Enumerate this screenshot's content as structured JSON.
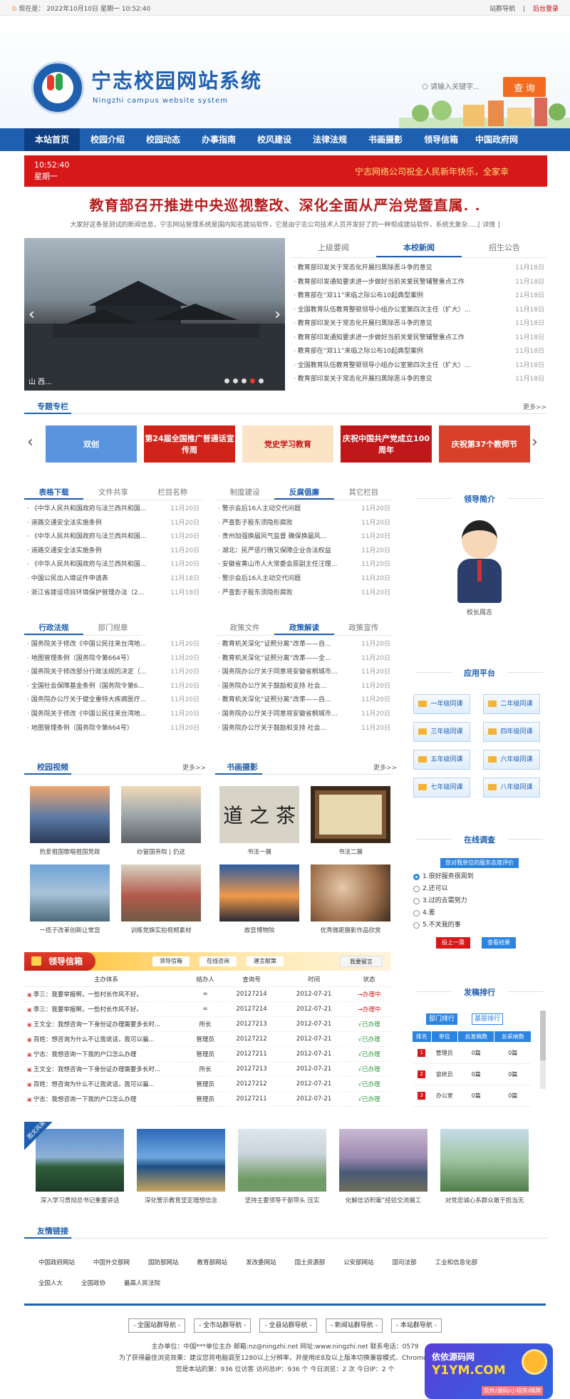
{
  "topbar": {
    "now_label": "现在是：",
    "datetime": "2022年10月10日 星期一 10:52:40",
    "sitegroup": "站群导航",
    "admin_login": "后台登录"
  },
  "header": {
    "title": "宁志校园网站系统",
    "subtitle": "Ningzhi campus website system",
    "search_placeholder": "请输入关键字...",
    "search_button": "查 询"
  },
  "nav": [
    "本站首页",
    "校园介绍",
    "校园动态",
    "办事指南",
    "校风建设",
    "法律法规",
    "书画摄影",
    "领导信箱",
    "中国政府网"
  ],
  "ticker": {
    "time": "10:52:40",
    "weekday": "星期一",
    "message": "宁志网络公司祝全人民新年快乐，全家幸"
  },
  "headline": {
    "title": "教育部召开推进中央巡视整改、深化全面从严治党暨直属. .",
    "desc": "大家好这条是测试的新闻信息，宁志网站管理系统是国内知名建站软件，它是由宁志公司技术人员开发好了的一种现成建站软件，系统无复杂.....[ 详情 ]"
  },
  "slider": {
    "caption": "山 西..."
  },
  "news": {
    "tabs": [
      "上级要闻",
      "本校新闻",
      "招生公告"
    ],
    "items": [
      {
        "t": "教育部印发关于常态化开展扫黑除恶斗争的意见",
        "d": "11月18日"
      },
      {
        "t": "教育部印发通知要求进一步做好当前关爱民警辅警重点工作",
        "d": "11月18日"
      },
      {
        "t": "教育部在“双11”来临之际公布10起典型案例",
        "d": "11月18日"
      },
      {
        "t": "全国教育队伍教育整顿领导小组办公室第四次主任（扩大）...",
        "d": "11月18日"
      },
      {
        "t": "教育部印发关于常态化开展扫黑除恶斗争的意见",
        "d": "11月18日"
      },
      {
        "t": "教育部印发通知要求进一步做好当前关爱民警辅警重点工作",
        "d": "11月18日"
      },
      {
        "t": "教育部在“双11”来临之际公布10起典型案例",
        "d": "11月18日"
      },
      {
        "t": "全国教育队伍教育整顿领导小组办公室第四次主任（扩大）...",
        "d": "11月18日"
      },
      {
        "t": "教育部印发关于常态化开展扫黑除恶斗争的意见",
        "d": "11月18日"
      }
    ]
  },
  "special": {
    "title": "专题专栏",
    "more": "更多>>",
    "banners": [
      "双创",
      "第24届全国推广普通话宣传周",
      "党史学习教育",
      "庆祝中国共产党成立100周年",
      "庆祝第37个教师节"
    ]
  },
  "col1": {
    "tabs": [
      "表格下载",
      "文件共享",
      "栏目名称"
    ],
    "items": [
      {
        "t": "《中华人民共和国政府与法兰西共和国...",
        "d": "11月20日"
      },
      {
        "t": "道路交通安全法实施条例",
        "d": "11月20日"
      },
      {
        "t": "《中华人民共和国政府与法兰西共和国...",
        "d": "11月20日"
      },
      {
        "t": "道路交通安全法实施条例",
        "d": "11月20日"
      },
      {
        "t": "《中华人民共和国政府与法兰西共和国...",
        "d": "11月20日"
      },
      {
        "t": "中国公民出入境证件申请表",
        "d": "11月18日"
      },
      {
        "t": "浙江省建设项目环境保护管理办法（2...",
        "d": "11月18日"
      }
    ]
  },
  "col2": {
    "tabs": [
      "制度建设",
      "反腐倡廉",
      "其它栏目"
    ],
    "items": [
      {
        "t": "警示会后16人主动交代问题",
        "d": "11月20日"
      },
      {
        "t": "严查影子股东须隐形腐败",
        "d": "11月20日"
      },
      {
        "t": "贵州加强换届风气监督 确保换届风...",
        "d": "11月20日"
      },
      {
        "t": "湖北：民严惩行贿又保障企业合法权益",
        "d": "11月20日"
      },
      {
        "t": "安徽省黄山市人大常委会原副主任汪理...",
        "d": "11月20日"
      },
      {
        "t": "警示会后16人主动交代问题",
        "d": "11月20日"
      },
      {
        "t": "严查影子股东须隐形腐败",
        "d": "11月20日"
      }
    ]
  },
  "col3": {
    "tabs": [
      "行政法规",
      "部门规章"
    ],
    "items": [
      {
        "t": "国务院关于修改《中国公民往来台湾地...",
        "d": "11月20日"
      },
      {
        "t": "地图管理条例（国务院令第664号）",
        "d": "11月20日"
      },
      {
        "t": "国务院关于修改部分行政法规的决定（...",
        "d": "11月20日"
      },
      {
        "t": "全国社会保障基金条例（国务院令第6...",
        "d": "11月20日"
      },
      {
        "t": "国务院办公厅关于健全重特大疾病医疗...",
        "d": "11月20日"
      },
      {
        "t": "国务院关于修改《中国公民往来台湾地...",
        "d": "11月20日"
      },
      {
        "t": "地图管理条例（国务院令第664号）",
        "d": "11月20日"
      }
    ]
  },
  "col4": {
    "tabs": [
      "政策文件",
      "政策解读",
      "政策宣传"
    ],
    "items": [
      {
        "t": "教育机关深化“证照分离”改革——自...",
        "d": "11月20日"
      },
      {
        "t": "教育机关深化“证照分离”改革——全...",
        "d": "11月20日"
      },
      {
        "t": "国务院办公厅关于同意将安徽省桐城市 列...",
        "d": "11月20日"
      },
      {
        "t": "国务院办公厅关于鼓励和支持 社会...",
        "d": "11月20日"
      },
      {
        "t": "教育机关深化“证照分离”改革——自...",
        "d": "11月20日"
      },
      {
        "t": "国务院办公厅关于同意将安徽省桐城市 列...",
        "d": "11月20日"
      },
      {
        "t": "国务院办公厅关于鼓励和支持 社会...",
        "d": "11月20日"
      }
    ]
  },
  "side": {
    "leader_title": "领导简介",
    "leader_caption": "校长周志",
    "apps_title": "应用平台",
    "apps": [
      "一年级同课",
      "二年级同课",
      "三年级同课",
      "四年级同课",
      "五年级同课",
      "六年级同课",
      "七年级同课",
      "八年级同课"
    ],
    "survey_title": "在线调查",
    "survey_q": "您对我单位的服务态度评价",
    "survey_opts": [
      "1.很好服务很周到",
      "2.还可以",
      "3.过的去需努力",
      "4.差",
      "5.不关我的事"
    ],
    "survey_vote": "投上一票",
    "survey_result": "查看结果",
    "rank_title": "发稿排行",
    "rank_tabs": [
      "部门排行",
      "基层排行"
    ],
    "rank_headers": [
      "排名",
      "单位",
      "总发稿数",
      "总采纳数"
    ],
    "rank_rows": [
      {
        "n": "1",
        "u": "管理员",
        "a": "0篇",
        "b": "0篇"
      },
      {
        "n": "2",
        "u": "宙统员",
        "a": "0篇",
        "b": "0篇"
      },
      {
        "n": "3",
        "u": "办公室",
        "a": "0篇",
        "b": "0篇"
      }
    ]
  },
  "video": {
    "title": "校园视频",
    "more": "更多>>",
    "items": [
      "热爱祖国歌唱祖国党政",
      "纱窗国务院 | 仍这",
      "一揽子改革创新让常宫",
      "训练党旗实拍视频素材"
    ]
  },
  "photo": {
    "title": "书画摄影",
    "more": "更多>>",
    "items": [
      "书法一展",
      "书法二展",
      "故宫博物院",
      "优秀微距摄影作品欣赏"
    ]
  },
  "letters": {
    "title": "领导信箱",
    "tabs": [
      "领导信箱",
      "在线咨询",
      "建言献策"
    ],
    "write": "我要留言",
    "headers": [
      "主办体系",
      "结办人",
      "查询号",
      "时间",
      "状态"
    ],
    "rows": [
      {
        "s": "李三：我要举报啊，一些村长作风不好。",
        "p": "=",
        "q": "20127214",
        "t": "2012-07-21",
        "st": "办理中",
        "g": false
      },
      {
        "s": "李三：我要举报啊，一些村长作风不好。",
        "p": "=",
        "q": "20127214",
        "t": "2012-07-21",
        "st": "办理中",
        "g": false
      },
      {
        "s": "王文全：我想咨询一下身份证办理需要多长时...",
        "p": "所长",
        "q": "20127213",
        "t": "2012-07-21",
        "st": "已办理",
        "g": true
      },
      {
        "s": "百姓：想咨询为什么不让我说话，我可以骗...",
        "p": "管理员",
        "q": "20127212",
        "t": "2012-07-21",
        "st": "已办理",
        "g": true
      },
      {
        "s": "宁志：我想咨询一下我的户口怎么办理",
        "p": "管理员",
        "q": "20127211",
        "t": "2012-07-21",
        "st": "已办理",
        "g": true
      },
      {
        "s": "王文全：我想咨询一下身份证办理需要多长时...",
        "p": "所长",
        "q": "20127213",
        "t": "2012-07-21",
        "st": "已办理",
        "g": true
      },
      {
        "s": "百姓：想咨询为什么不让我说话，我可以骗...",
        "p": "管理员",
        "q": "20127212",
        "t": "2012-07-21",
        "st": "已办理",
        "g": true
      },
      {
        "s": "宁志：我想咨询一下我的户口怎么办理",
        "p": "管理员",
        "q": "20127211",
        "t": "2012-07-21",
        "st": "已办理",
        "g": true
      }
    ]
  },
  "culture": {
    "ribbon": "图文风采",
    "items": [
      "深入学习贯彻总书记重要讲话",
      "深化警示教育坚定理想信念",
      "坚持主要领导干部带头 压实",
      "化解信访积案”经验交流展工",
      "对党忠诚心系群众敢于担当无"
    ]
  },
  "friends": {
    "title": "友情链接",
    "items": [
      "中国政府网站",
      "中国外交部网",
      "国防部网站",
      "教育部网站",
      "发改委网站",
      "国土资源部",
      "公安部网站",
      "国司法部",
      "工业和信息化部",
      "全国人大",
      "全国政协",
      "最高人民法院"
    ]
  },
  "footer": {
    "selects": [
      "- 全国站群导航 -",
      "- 全市站群导航 -",
      "- 全县站群导航 -",
      "- 新闻站群导航 -",
      "- 本站群导航 -"
    ],
    "line1": "主办单位：中国***单位主办  邮箱:nz@ningzhi.net  网址:www.ningzhi.net  联系电话：0579",
    "line2": "为了获得最佳浏览效果：建议您将电脑调至1280以上分辨率，并使用IE8及以上版本切换兼容模式、Chrome、Firefo",
    "line3": "您是本站的第：936 位访客  访问总IP：936 个  今日浏览：2 次  今日IP：2 个",
    "badge1": "依依源码网",
    "badge2": "Y1YM.COM",
    "badge3": "软件/源码/小程序/棋牌"
  }
}
